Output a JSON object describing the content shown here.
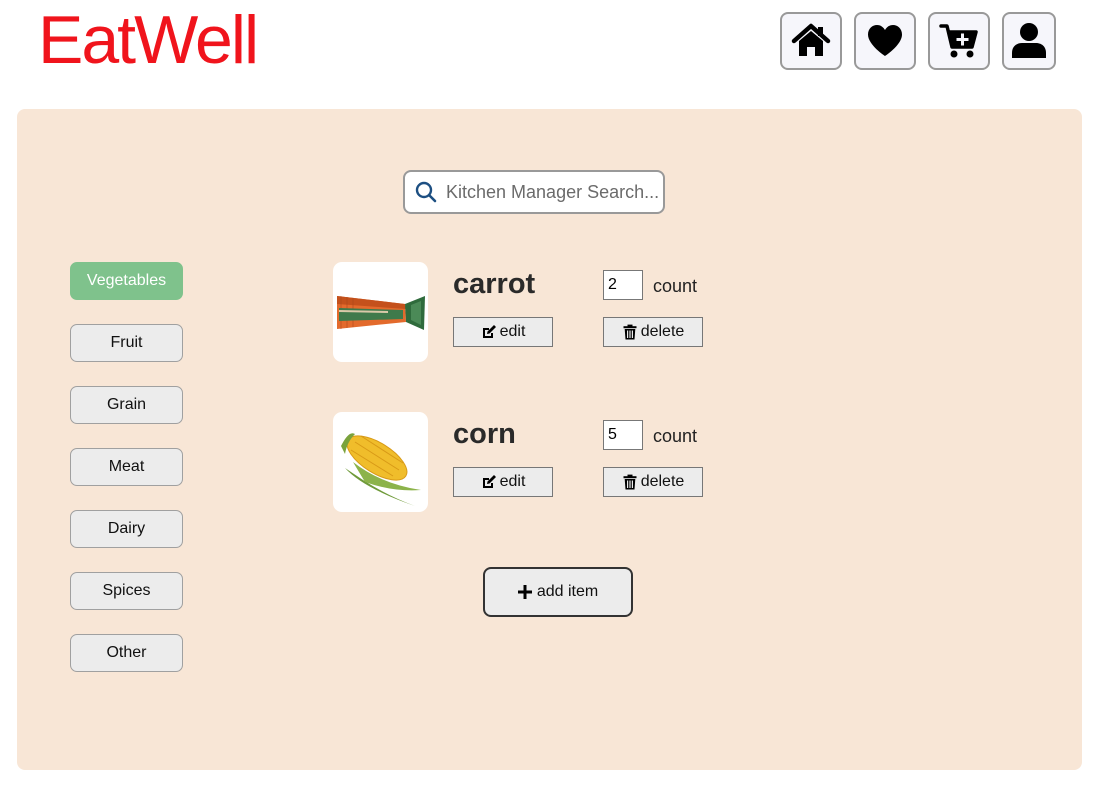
{
  "app": {
    "title": "EatWell"
  },
  "nav": [
    {
      "id": "home",
      "icon": "home-icon"
    },
    {
      "id": "favorites",
      "icon": "heart-icon"
    },
    {
      "id": "cart",
      "icon": "cart-plus-icon"
    },
    {
      "id": "profile",
      "icon": "user-icon"
    }
  ],
  "search": {
    "placeholder": "Kitchen Manager Search...",
    "value": ""
  },
  "categories": {
    "selected": "Vegetables",
    "items": [
      "Vegetables",
      "Fruit",
      "Grain",
      "Meat",
      "Dairy",
      "Spices",
      "Other"
    ]
  },
  "items": [
    {
      "name": "carrot",
      "count": "2",
      "count_label": "count",
      "edit_label": "edit",
      "delete_label": "delete",
      "image": "carrot-photo"
    },
    {
      "name": "corn",
      "count": "5",
      "count_label": "count",
      "edit_label": "edit",
      "delete_label": "delete",
      "image": "corn-photo"
    }
  ],
  "add_item_label": "add item",
  "colors": {
    "brand": "#f0141c",
    "panel": "#f8e6d6",
    "active_category": "#7fc28c",
    "button": "#ececec"
  }
}
